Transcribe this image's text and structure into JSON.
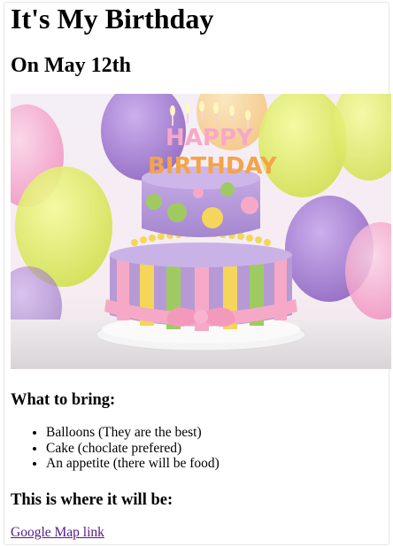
{
  "page": {
    "title": "It's My Birthday",
    "subtitle": "On May 12th"
  },
  "hero_image": {
    "cake_topper_lines": [
      "HAPPY",
      "BIRTHDAY"
    ],
    "colors": {
      "cake_purple": "#b69ad6",
      "ribbon_pink": "#f6a9c6",
      "balloon_yellow": "#e3f063",
      "balloon_purple": "#a57fd0",
      "dot_green": "#9fca62",
      "dot_yellow": "#f3d65a"
    }
  },
  "bring_section": {
    "heading": "What to bring:",
    "items": [
      "Balloons (They are the best)",
      "Cake (choclate prefered)",
      "An appetite (there will be food)"
    ]
  },
  "location_section": {
    "heading": "This is where it will be:",
    "link_text": "Google Map link"
  }
}
